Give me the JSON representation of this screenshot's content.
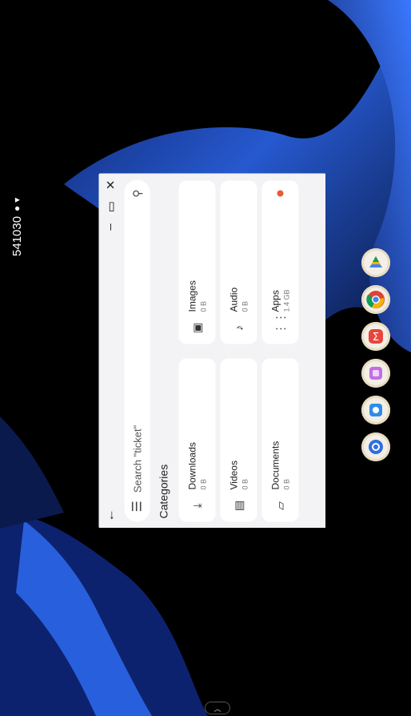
{
  "status_bar": {
    "time": "541030",
    "badge_icon": "person-icon",
    "signal_icon": "signal-icon"
  },
  "window": {
    "back_icon": "arrow-icon",
    "controls": [
      "minimize-icon",
      "maximize-icon",
      "close-icon"
    ],
    "search": {
      "menu_icon": "menu-icon",
      "placeholder": "Search \"ticket\"",
      "search_icon": "search-icon"
    },
    "categories_title": "Categories",
    "categories": [
      {
        "name": "Downloads",
        "size": "0 B",
        "icon": "download-icon"
      },
      {
        "name": "Images",
        "size": "0 B",
        "icon": "image-icon"
      },
      {
        "name": "Videos",
        "size": "0 B",
        "icon": "video-icon"
      },
      {
        "name": "Audio",
        "size": "0 B",
        "icon": "audio-icon"
      },
      {
        "name": "Documents",
        "size": "0 B",
        "icon": "document-icon"
      },
      {
        "name": "Apps",
        "size": "1.4 GB",
        "icon": "apps-icon",
        "has_dot": true
      }
    ]
  },
  "dock": {
    "apps": [
      {
        "name": "Drive",
        "icon": "drive-icon",
        "color": "#f4b400"
      },
      {
        "name": "Chrome",
        "icon": "chrome-icon",
        "color": "#db4437"
      },
      {
        "name": "Sigma",
        "icon": "sigma-icon",
        "color": "#e8453c"
      },
      {
        "name": "Gallery",
        "icon": "gallery-icon",
        "color": "#b04fd8"
      },
      {
        "name": "Remote",
        "icon": "remote-icon",
        "color": "#2d8de8"
      },
      {
        "name": "Settings",
        "icon": "settings-icon",
        "color": "#2f6fe0"
      }
    ]
  },
  "colors": {
    "accent": "#ea5b36",
    "wallpaper_blue": "#1f4fbf",
    "window_bg": "#f3f3f5"
  }
}
